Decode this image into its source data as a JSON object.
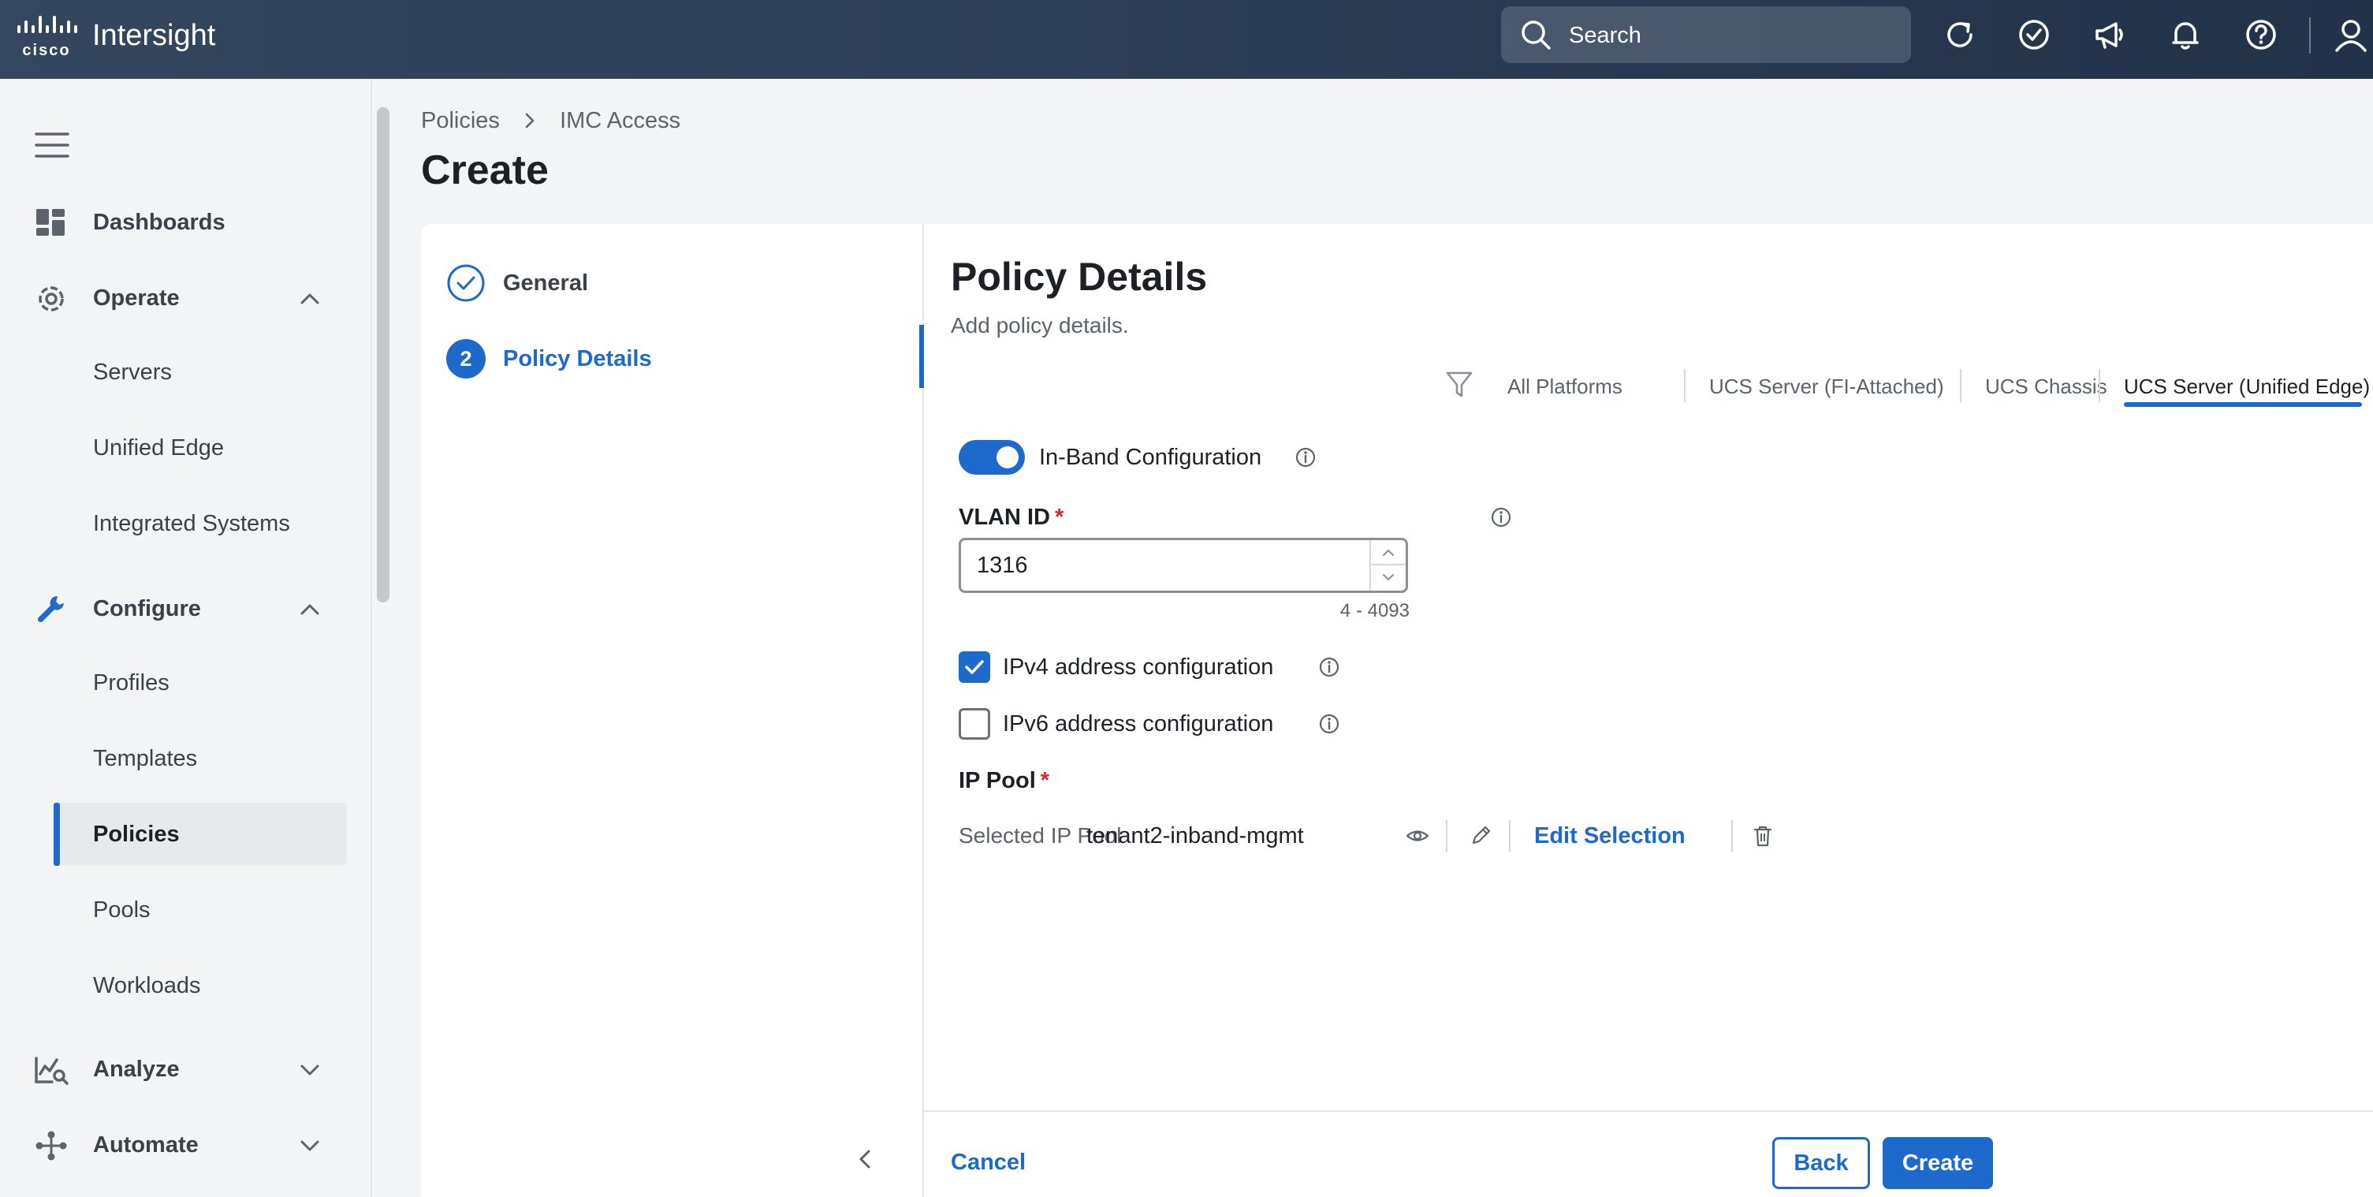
{
  "app": {
    "brand": "Intersight",
    "logo_text": "cisco"
  },
  "topbar": {
    "search_label": "Search",
    "icons": [
      "refresh-icon",
      "check-circle-icon",
      "megaphone-icon",
      "bell-icon",
      "help-icon",
      "user-icon"
    ]
  },
  "sidebar": {
    "sections": [
      {
        "label": "Dashboards",
        "icon": "dashboard-icon"
      },
      {
        "label": "Operate",
        "icon": "operate-icon",
        "expanded": true,
        "items": [
          "Servers",
          "Unified Edge",
          "Integrated Systems"
        ]
      },
      {
        "label": "Configure",
        "icon": "wrench-icon",
        "expanded": true,
        "items": [
          "Profiles",
          "Templates",
          "Policies",
          "Pools",
          "Workloads"
        ],
        "active_item": "Policies"
      },
      {
        "label": "Analyze",
        "icon": "analyze-icon",
        "expanded": false
      },
      {
        "label": "Automate",
        "icon": "automate-icon",
        "expanded": false
      }
    ]
  },
  "breadcrumb": {
    "items": [
      "Policies",
      "IMC Access"
    ]
  },
  "page": {
    "title": "Create"
  },
  "steps": [
    {
      "label": "General",
      "state": "complete"
    },
    {
      "number": "2",
      "label": "Policy Details",
      "state": "current"
    }
  ],
  "policy": {
    "title": "Policy Details",
    "subtitle": "Add policy details.",
    "platform_tabs": [
      "All Platforms",
      "UCS Server (FI-Attached)",
      "UCS Chassis",
      "UCS Server (Unified Edge)"
    ],
    "active_platform_tab": "UCS Server (Unified Edge)",
    "inband_label": "In-Band Configuration",
    "inband_enabled": true,
    "vlan_label": "VLAN ID",
    "vlan_value": "1316",
    "vlan_range": "4 - 4093",
    "ipv4_label": "IPv4 address configuration",
    "ipv4_checked": true,
    "ipv6_label": "IPv6 address configuration",
    "ipv6_checked": false,
    "ip_pool_label": "IP Pool",
    "selected_pool_label": "Selected IP Pool",
    "selected_pool_value": "tenant2-inband-mgmt",
    "edit_selection_label": "Edit Selection",
    "required_marker": "*"
  },
  "footer": {
    "cancel_label": "Cancel",
    "back_label": "Back",
    "create_label": "Create"
  },
  "colors": {
    "accent": "#1d69cc",
    "topbar": "#2c3e55",
    "required": "#cc2d37"
  }
}
